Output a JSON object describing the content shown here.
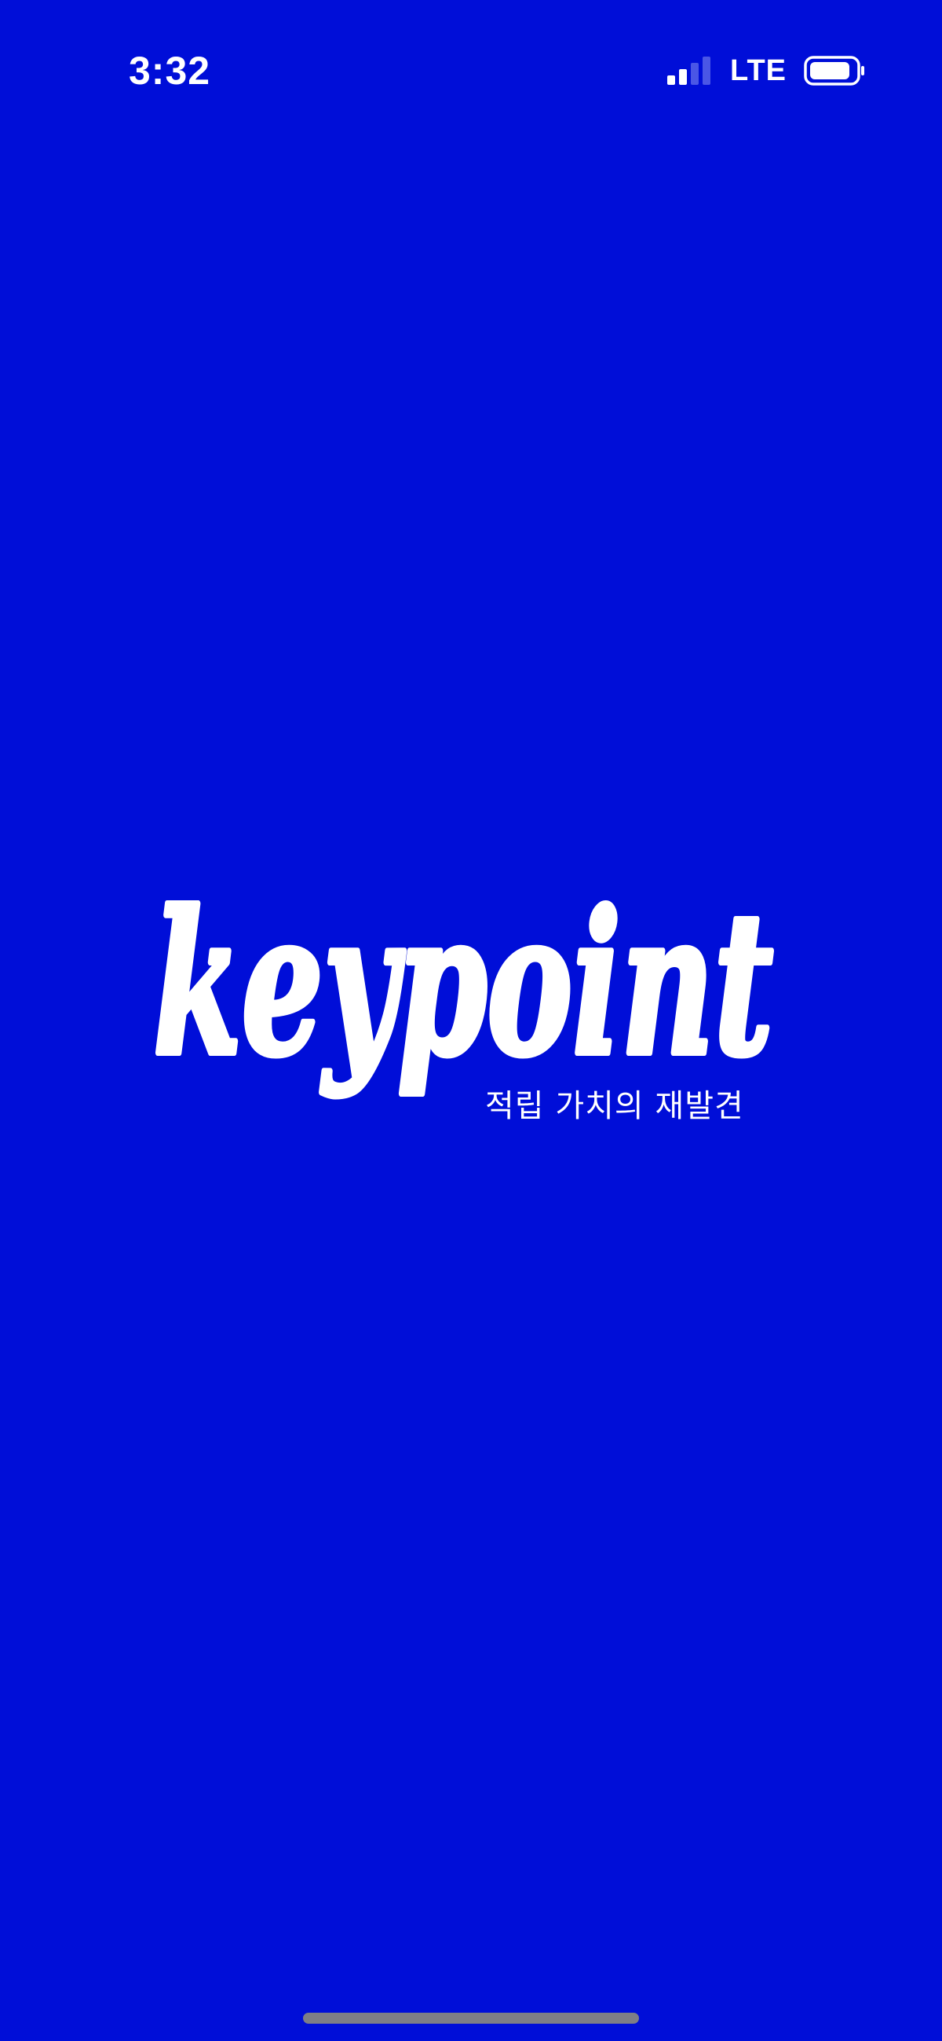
{
  "status_bar": {
    "time": "3:32",
    "network": "LTE",
    "signal_icon": "cellular-signal-icon",
    "battery_icon": "battery-icon"
  },
  "splash": {
    "logo_text": "keypoint",
    "tagline": "적립 가치의 재발견"
  },
  "colors": {
    "background": "#000ED8",
    "foreground": "#FFFFFF",
    "home_indicator": "#7E7E86"
  }
}
